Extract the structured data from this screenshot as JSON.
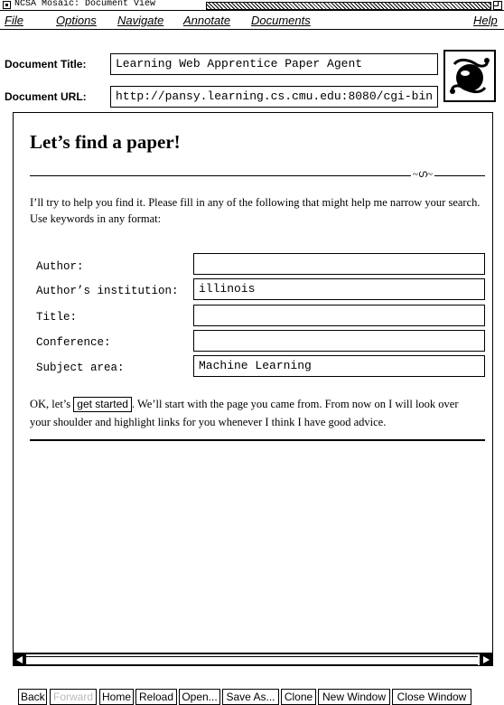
{
  "window": {
    "title": "NCSA Mosaic: Document View"
  },
  "menubar": {
    "file": "File",
    "options": "Options",
    "navigate": "Navigate",
    "annotate": "Annotate",
    "documents": "Documents",
    "help": "Help"
  },
  "doc_info": {
    "title_label": "Document Title:",
    "title_value": "Learning Web Apprentice Paper Agent",
    "url_label": "Document URL:",
    "url_value": "http://pansy.learning.cs.cmu.edu:8080/cgi-bin"
  },
  "page": {
    "heading": "Let’s find a paper!",
    "intro": "I’ll try to help you find it. Please fill in any of the following that might help me narrow your search. Use keywords in any format:",
    "form": [
      {
        "label": "Author:",
        "value": ""
      },
      {
        "label": "Author’s institution:",
        "value": "illinois"
      },
      {
        "label": "Title:",
        "value": ""
      },
      {
        "label": "Conference:",
        "value": ""
      },
      {
        "label": "Subject area:",
        "value": "Machine Learning"
      }
    ],
    "outro_before": "OK, let’s",
    "get_started": "get started",
    "outro_line1_after": ". We’ll start with the page you came from. From now on I will look over",
    "outro_line2": "your shoulder and highlight links for you whenever I think I have good advice."
  },
  "buttons": {
    "back": "Back",
    "forward": "Forward",
    "home": "Home",
    "reload": "Reload",
    "open": "Open...",
    "save_as": "Save As...",
    "clone": "Clone",
    "new_window": "New Window",
    "close_window": "Close Window"
  }
}
